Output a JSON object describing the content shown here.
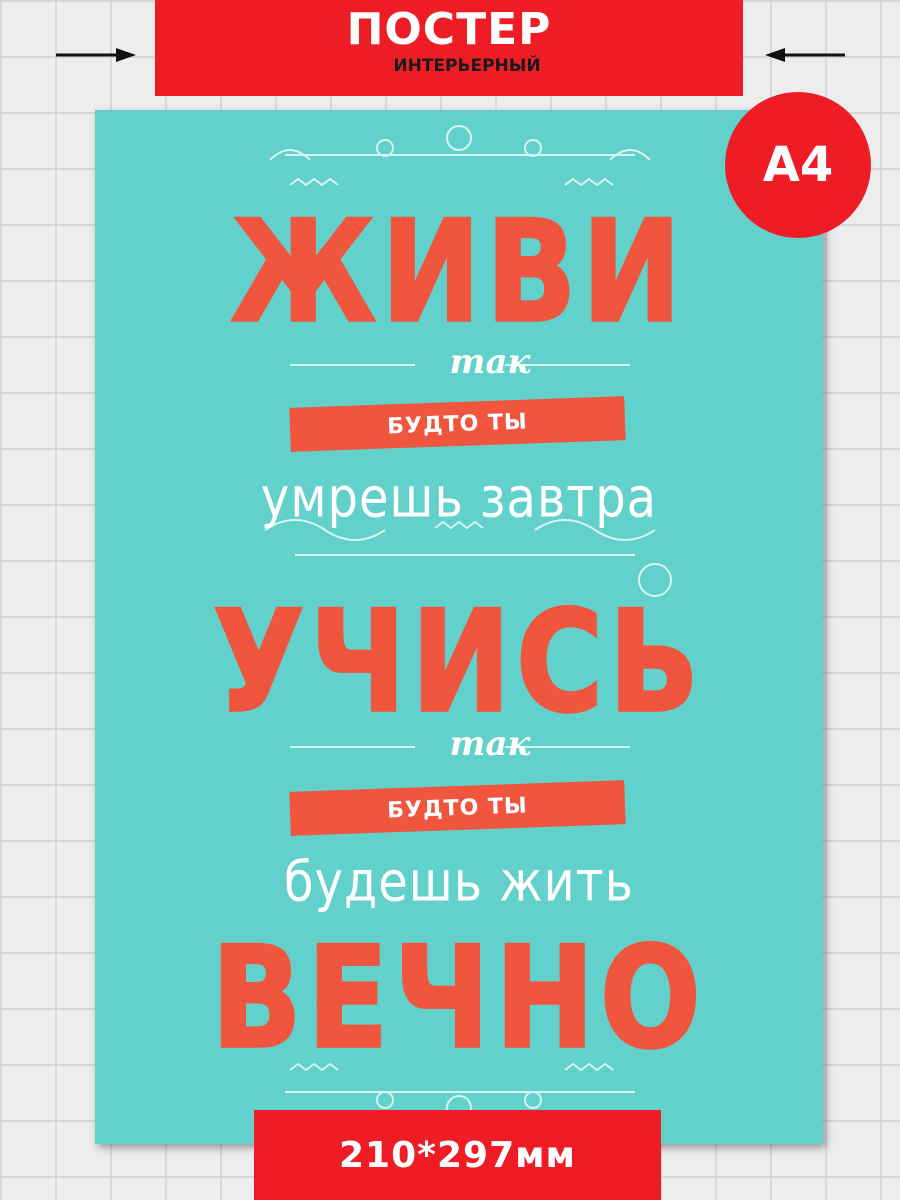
{
  "header": {
    "title": "ПОСТЕР",
    "subtitle": "ИНТЕРЬЕРНЫЙ"
  },
  "badge": {
    "size_label": "А4"
  },
  "poster": {
    "word_1": "ЖИВИ",
    "tak_1": "так",
    "ribbon_1": "БУДТО ТЫ",
    "line_1": "умрешь завтра",
    "word_2": "УЧИСЬ",
    "tak_2": "так",
    "ribbon_2": "БУДТО ТЫ",
    "line_2": "будешь жить",
    "word_3": "ВЕЧНО"
  },
  "footer": {
    "dimensions": "210*297мм"
  },
  "colors": {
    "brand_red": "#ee1c25",
    "poster_teal": "#63d1cb",
    "lettering_coral": "#f0553d",
    "wall": "#ededed"
  },
  "icons": [
    "arrow-right-icon",
    "arrow-left-icon"
  ]
}
